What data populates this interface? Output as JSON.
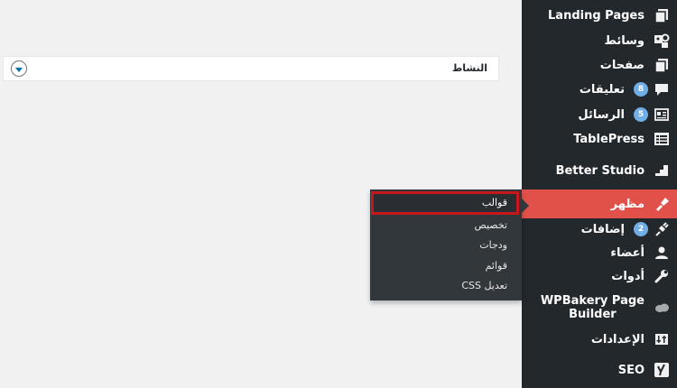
{
  "activity_panel": {
    "title": "النشاط",
    "toggle_icon": "chevron-down-icon"
  },
  "sidebar": {
    "items": [
      {
        "label": "Landing Pages",
        "icon": "pages-icon"
      },
      {
        "label": "وسائط",
        "icon": "media-icon"
      },
      {
        "label": "صفحات",
        "icon": "pages-icon"
      },
      {
        "label": "تعليقات",
        "icon": "comments-icon",
        "badge": "8"
      },
      {
        "label": "الرسائل",
        "icon": "messages-icon",
        "badge": "5"
      },
      {
        "label": "TablePress",
        "icon": "table-icon"
      },
      {
        "label": "Better Studio",
        "icon": "chart-icon"
      },
      {
        "label": "مظهر",
        "icon": "appearance-icon",
        "active": true
      },
      {
        "label": "إضافات",
        "icon": "plugins-icon",
        "badge": "2"
      },
      {
        "label": "أعضاء",
        "icon": "users-icon"
      },
      {
        "label": "أدوات",
        "icon": "tools-icon"
      },
      {
        "label": "WPBakery Page Builder",
        "line1": "WPBakery Page",
        "line2": "Builder",
        "icon": "cloud-icon"
      },
      {
        "label": "الإعدادات",
        "icon": "settings-icon"
      },
      {
        "label": "SEO",
        "icon": "yoast-icon"
      }
    ]
  },
  "appearance_submenu": {
    "items": [
      "قوالب",
      "تخصيص",
      "ودجات",
      "قوائم",
      "تعديل CSS"
    ]
  },
  "colors": {
    "sidebar_bg": "#23282d",
    "active_bg": "#e1514a",
    "flyout_bg": "#32373c",
    "highlight_border": "#c8161d",
    "badge": "#72aee6"
  }
}
